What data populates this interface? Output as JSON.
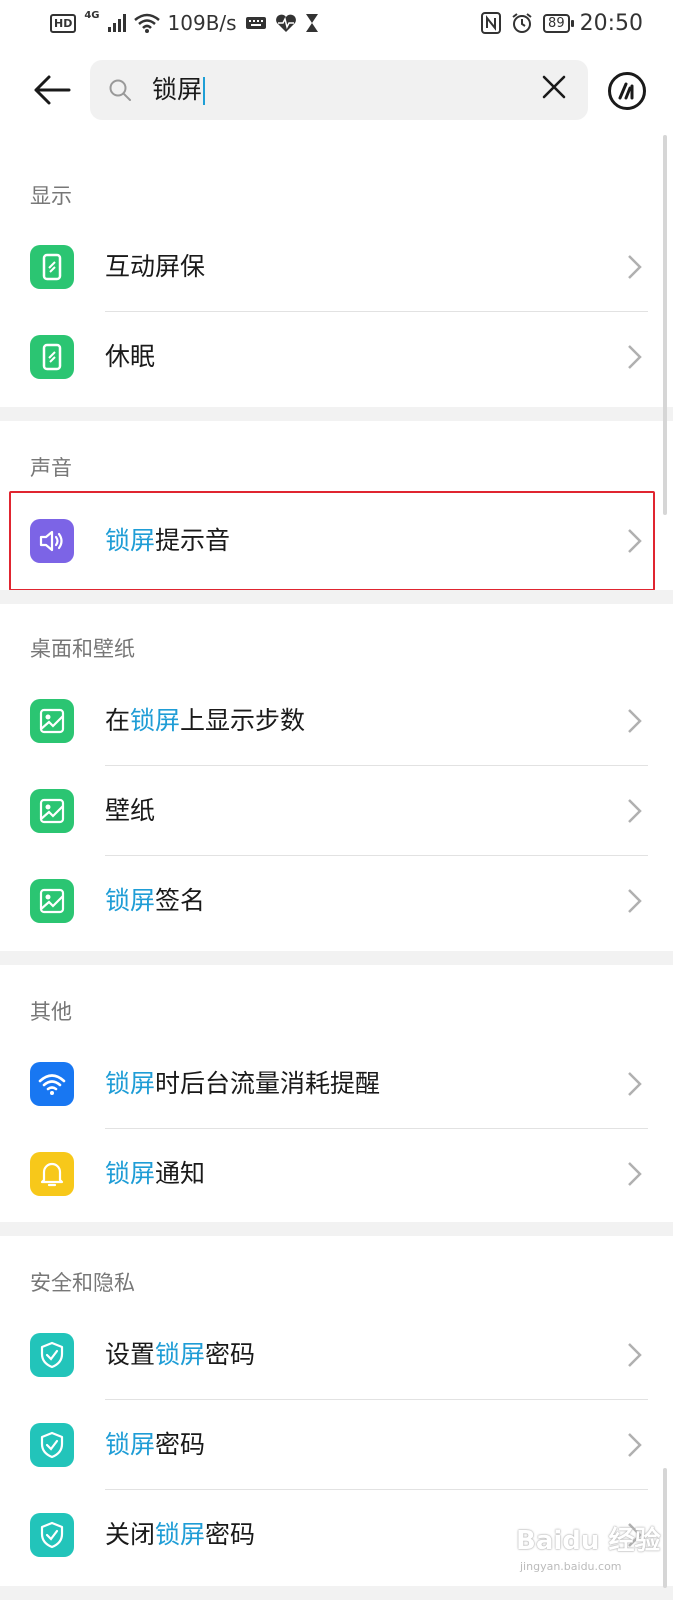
{
  "status_bar": {
    "hd": "HD",
    "signal_type": "4G",
    "net_speed": "109B/s",
    "battery": "89",
    "time": "20:50"
  },
  "search": {
    "query": "锁屏"
  },
  "sections": [
    {
      "title": "显示",
      "items": [
        {
          "parts": [
            {
              "t": "互动屏保",
              "hl": false
            }
          ],
          "icon": "phone-icon",
          "color": "#2bc572"
        },
        {
          "parts": [
            {
              "t": "休眠",
              "hl": false
            }
          ],
          "icon": "phone-icon",
          "color": "#2bc572"
        }
      ]
    },
    {
      "title": "声音",
      "items": [
        {
          "parts": [
            {
              "t": "锁屏",
              "hl": true
            },
            {
              "t": "提示音",
              "hl": false
            }
          ],
          "icon": "speaker-icon",
          "color": "#7c64e6"
        }
      ]
    },
    {
      "title": "桌面和壁纸",
      "items": [
        {
          "parts": [
            {
              "t": "在",
              "hl": false
            },
            {
              "t": "锁屏",
              "hl": true
            },
            {
              "t": "上显示步数",
              "hl": false
            }
          ],
          "icon": "image-icon",
          "color": "#2bc572"
        },
        {
          "parts": [
            {
              "t": "壁纸",
              "hl": false
            }
          ],
          "icon": "image-icon",
          "color": "#2bc572"
        },
        {
          "parts": [
            {
              "t": "锁屏",
              "hl": true
            },
            {
              "t": "签名",
              "hl": false
            }
          ],
          "icon": "image-icon",
          "color": "#2bc572"
        }
      ]
    },
    {
      "title": "其他",
      "items": [
        {
          "parts": [
            {
              "t": "锁屏",
              "hl": true
            },
            {
              "t": "时后台流量消耗提醒",
              "hl": false
            }
          ],
          "icon": "wifi-icon",
          "color": "#1877f2"
        },
        {
          "parts": [
            {
              "t": "锁屏",
              "hl": true
            },
            {
              "t": "通知",
              "hl": false
            }
          ],
          "icon": "bell-icon",
          "color": "#f7c81a"
        }
      ]
    },
    {
      "title": "安全和隐私",
      "items": [
        {
          "parts": [
            {
              "t": "设置",
              "hl": false
            },
            {
              "t": "锁屏",
              "hl": true
            },
            {
              "t": "密码",
              "hl": false
            }
          ],
          "icon": "shield-icon",
          "color": "#22c4ba"
        },
        {
          "parts": [
            {
              "t": "锁屏",
              "hl": true
            },
            {
              "t": "密码",
              "hl": false
            }
          ],
          "icon": "shield-icon",
          "color": "#22c4ba"
        },
        {
          "parts": [
            {
              "t": "关闭",
              "hl": false
            },
            {
              "t": "锁屏",
              "hl": true
            },
            {
              "t": "密码",
              "hl": false
            }
          ],
          "icon": "shield-icon",
          "color": "#22c4ba"
        }
      ]
    }
  ],
  "watermark": {
    "text": "Baidu 经验",
    "sub": "jingyan.baidu.com"
  }
}
